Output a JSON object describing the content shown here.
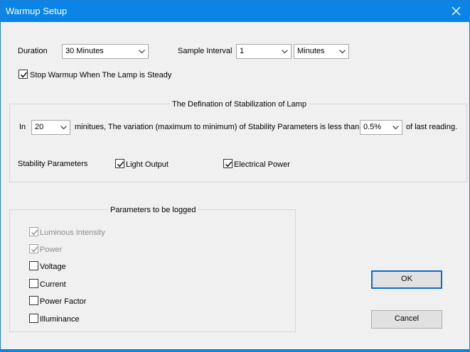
{
  "window": {
    "title": "Warmup Setup"
  },
  "duration": {
    "label": "Duration",
    "value": "30 Minutes"
  },
  "sample_interval": {
    "label": "Sample Interval",
    "value": "1",
    "unit": "Minutes"
  },
  "stop_warmup": {
    "label": "Stop Warmup When The Lamp is Steady",
    "checked": true
  },
  "stabilization": {
    "title": "The Defination of Stabilization of Lamp",
    "in_label": "In",
    "minutes_value": "20",
    "sentence": "minitues, The variation (maximum to minimum) of Stability Parameters is less than",
    "percent_value": "0.5%",
    "tail": "of last reading.",
    "params_label": "Stability Parameters",
    "light_output": {
      "label": "Light Output",
      "checked": true
    },
    "electrical_power": {
      "label": "Electrical Power",
      "checked": true
    }
  },
  "logged": {
    "title": "Parameters to be logged",
    "items": [
      {
        "label": "Luminous Intensity",
        "checked": true,
        "disabled": true
      },
      {
        "label": "Power",
        "checked": true,
        "disabled": true
      },
      {
        "label": "Voltage",
        "checked": false,
        "disabled": false
      },
      {
        "label": "Current",
        "checked": false,
        "disabled": false
      },
      {
        "label": "Power Factor",
        "checked": false,
        "disabled": false
      },
      {
        "label": "Illuminance",
        "checked": false,
        "disabled": false
      }
    ]
  },
  "buttons": {
    "ok": "OK",
    "cancel": "Cancel"
  },
  "colors": {
    "titlebar": "#0a84e6",
    "dialog_bg": "#f0f0f0",
    "default_button_border": "#0a6cd0"
  }
}
